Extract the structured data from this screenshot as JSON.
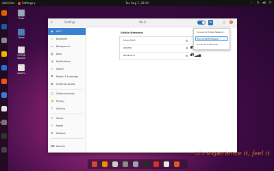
{
  "topbar": {
    "activities": "Activities",
    "app_name": "Settings ▾",
    "clock": "Tue Aug 7, 20:10",
    "tray": [
      "⋮",
      "⇅",
      "◀)",
      "⏻"
    ]
  },
  "dock": {
    "items": [
      {
        "name": "firefox",
        "color": "#e66000"
      },
      {
        "name": "thunderbird",
        "color": "#1e5aa8"
      },
      {
        "name": "files",
        "color": "#8a8a8a"
      },
      {
        "name": "rhythmbox",
        "color": "#f4b400"
      },
      {
        "name": "libreoffice-writer",
        "color": "#2a6ed4"
      },
      {
        "name": "software",
        "color": "#e95420"
      },
      {
        "name": "help",
        "color": "#3d7dd8"
      },
      {
        "name": "amazon",
        "color": "#e5e5e5"
      },
      {
        "name": "settings",
        "color": "#777777"
      },
      {
        "name": "terminal",
        "color": "#333333"
      },
      {
        "name": "apps",
        "color": "#444444"
      }
    ]
  },
  "desktop": {
    "icons": [
      {
        "label": "Trash",
        "color": "#9aa8b6"
      },
      {
        "label": "Home",
        "color": "#4a7fb8"
      },
      {
        "label": "3.07GB Volume",
        "color": "#dedede"
      },
      {
        "label": "ubuntu",
        "color": "#e6e6e6"
      }
    ]
  },
  "window": {
    "app_title": "Settings",
    "page_title": "Wi-Fi",
    "controls": [
      "–",
      "□",
      "×"
    ]
  },
  "sidebar": {
    "items": [
      {
        "label": "Wi-Fi",
        "icon": "◉"
      },
      {
        "label": "Bluetooth",
        "icon": "ᛒ"
      },
      {
        "label": "Background",
        "icon": "▭"
      },
      {
        "label": "Dock",
        "icon": "▥"
      },
      {
        "label": "Notifications",
        "icon": "◔"
      },
      {
        "label": "Search",
        "icon": "⌕"
      },
      {
        "label": "Region & Language",
        "icon": "⚑"
      },
      {
        "label": "Universal Access",
        "icon": "✪"
      },
      {
        "label": "Online Accounts",
        "icon": "◯"
      },
      {
        "label": "Privacy",
        "icon": "✋"
      },
      {
        "label": "Sharing",
        "icon": "⇪"
      },
      {
        "label": "Sound",
        "icon": "♪"
      },
      {
        "label": "Power",
        "icon": "⚡"
      },
      {
        "label": "Network",
        "icon": "⇅"
      },
      {
        "label": "Devices",
        "icon": "⌨"
      }
    ]
  },
  "main": {
    "section_title": "Visible Networks",
    "networks": [
      {
        "name": "Linux/Unit",
        "signal": "▂▄▆",
        "secured": false
      },
      {
        "name": "ubuntu",
        "signal": "▂▄▆",
        "secured": true
      },
      {
        "name": "devilzone",
        "signal": "▂▄▆",
        "secured": true
      }
    ]
  },
  "menu": {
    "items": [
      {
        "label": "Connect to Hidden Network...",
        "highlighted": false
      },
      {
        "label": "Turn On Wi-Fi Hotspot...",
        "highlighted": true
      },
      {
        "label": "Known Wi-Fi Networks",
        "highlighted": false
      }
    ]
  },
  "taskbar": {
    "icons": [
      {
        "name": "chrome",
        "color": "#db4437"
      },
      {
        "name": "vlc",
        "color": "#f28b00"
      },
      {
        "name": "scissors",
        "color": "#cccccc"
      },
      {
        "name": "files",
        "color": "#8a8a8a"
      },
      {
        "name": "disks",
        "color": "#9aa5b1"
      },
      {
        "name": "terminal",
        "color": "#2b2b2b"
      },
      {
        "name": "pdf",
        "color": "#d93025"
      },
      {
        "name": "mail",
        "color": "#e8e8e8"
      },
      {
        "name": "settings",
        "color": "#e95420"
      }
    ]
  },
  "brand": {
    "main": "experience it, feel it",
    "prefix": "ntu"
  }
}
